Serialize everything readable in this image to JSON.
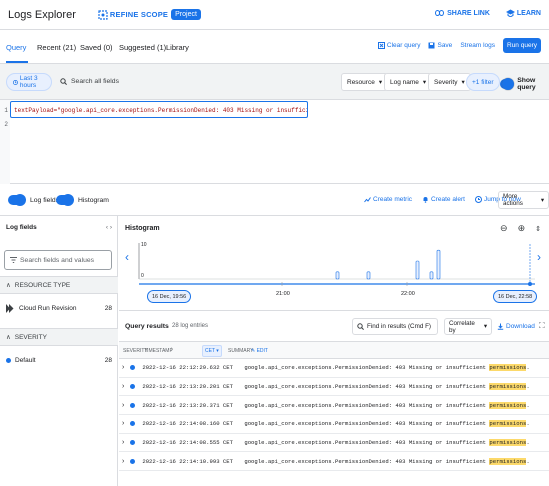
{
  "app": {
    "title": "Logs Explorer",
    "refine_scope": "REFINE SCOPE",
    "project_chip": "Project"
  },
  "top_links": {
    "share": "SHARE LINK",
    "learn": "LEARN"
  },
  "tabs": [
    {
      "label": "Query",
      "active": true
    },
    {
      "label": "Recent (21)"
    },
    {
      "label": "Saved (0)"
    },
    {
      "label": "Suggested (1)"
    },
    {
      "label": "Library"
    }
  ],
  "query_actions": {
    "clear": "Clear query",
    "save": "Save",
    "stream": "Stream logs",
    "run": "Run query"
  },
  "toolbar": {
    "time_range": "Last 3 hours",
    "search_placeholder": "Search all fields",
    "resource": "Resource",
    "log_name": "Log name",
    "severity": "Severity",
    "plus_filter": "+1 filter",
    "show_query": "Show query"
  },
  "editor": {
    "line_numbers": [
      "1",
      "2"
    ],
    "query_text": "textPayload=\"google.api_core.exceptions.PermissionDenied: 403 Missing or insufficient permissions.\""
  },
  "section_bar": {
    "log_fields_label": "Log fields",
    "histogram_label": "Histogram",
    "create_metric": "Create metric",
    "create_alert": "Create alert",
    "jump_to_now": "Jump to now",
    "more_actions": "More actions"
  },
  "left_panel": {
    "title": "Log fields",
    "search_placeholder": "Search fields and values",
    "sections": [
      {
        "header": "RESOURCE TYPE",
        "items": [
          {
            "label": "Cloud Run Revision",
            "count": "28"
          }
        ]
      },
      {
        "header": "SEVERITY",
        "items": [
          {
            "label": "Default",
            "count": "28"
          }
        ]
      }
    ]
  },
  "histogram": {
    "title": "Histogram",
    "y_top": "10",
    "y_bottom": "0",
    "start_label": "16 Dec, 19:56",
    "end_label": "16 Dec, 22:58",
    "ticks": [
      "21:00",
      "22:00"
    ],
    "bar_values": [
      2,
      2,
      5,
      2,
      8
    ]
  },
  "results": {
    "title": "Query results",
    "count": "28 log entries",
    "find_placeholder": "Find in results (Cmd F)",
    "correlate": "Correlate by",
    "download": "Download",
    "col_severity": "SEVERITY",
    "col_timestamp": "TIMESTAMP",
    "col_tz": "CET",
    "col_summary": "SUMMARY",
    "col_edit": "EDIT",
    "rows": [
      {
        "ts": "2022-12-16 22:12:29.632 CET",
        "msg": "google.api_core.exceptions.PermissionDenied: 403 Missing or insufficient",
        "hl": "permissions",
        "end": "."
      },
      {
        "ts": "2022-12-16 22:13:20.201 CET",
        "msg": "google.api_core.exceptions.PermissionDenied: 403 Missing or insufficient",
        "hl": "permissions",
        "end": "."
      },
      {
        "ts": "2022-12-16 22:13:20.371 CET",
        "msg": "google.api_core.exceptions.PermissionDenied: 403 Missing or insufficient",
        "hl": "permissions",
        "end": "."
      },
      {
        "ts": "2022-12-16 22:14:08.160 CET",
        "msg": "google.api_core.exceptions.PermissionDenied: 403 Missing or insufficient",
        "hl": "permissions",
        "end": "."
      },
      {
        "ts": "2022-12-16 22:14:08.555 CET",
        "msg": "google.api_core.exceptions.PermissionDenied: 403 Missing or insufficient",
        "hl": "permissions",
        "end": "."
      },
      {
        "ts": "2022-12-16 22:14:10.993 CET",
        "msg": "google.api_core.exceptions.PermissionDenied: 403 Missing or insufficient",
        "hl": "permissions",
        "end": "."
      }
    ]
  },
  "colors": {
    "accent": "#1a73e8",
    "highlight": "#fcd96a",
    "error_text": "#a50e0e"
  }
}
